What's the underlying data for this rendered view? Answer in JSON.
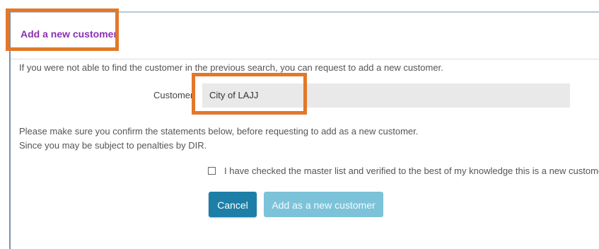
{
  "panel": {
    "title": "Add a new customer",
    "intro": "If you were not able to find the customer in the previous search, you can request to add a new customer."
  },
  "form": {
    "customer_label": "Customer",
    "customer_value": "City of LAJJ",
    "confirm_line1": "Please make sure you confirm the statements below, before requesting to add as a new customer.",
    "confirm_line2": "Since you may be subject to penalties by DIR.",
    "checkbox_label": "I have checked the master list and verified to the best of my knowledge this is a new customer.",
    "checkbox_checked": false
  },
  "buttons": {
    "cancel": "Cancel",
    "add": "Add as a new customer"
  },
  "colors": {
    "title": "#8a2fb1",
    "highlight": "#e2782a",
    "primary_button": "#1d7fa7",
    "disabled_button": "#7cc3d9",
    "field_background": "#e9e9e9"
  }
}
